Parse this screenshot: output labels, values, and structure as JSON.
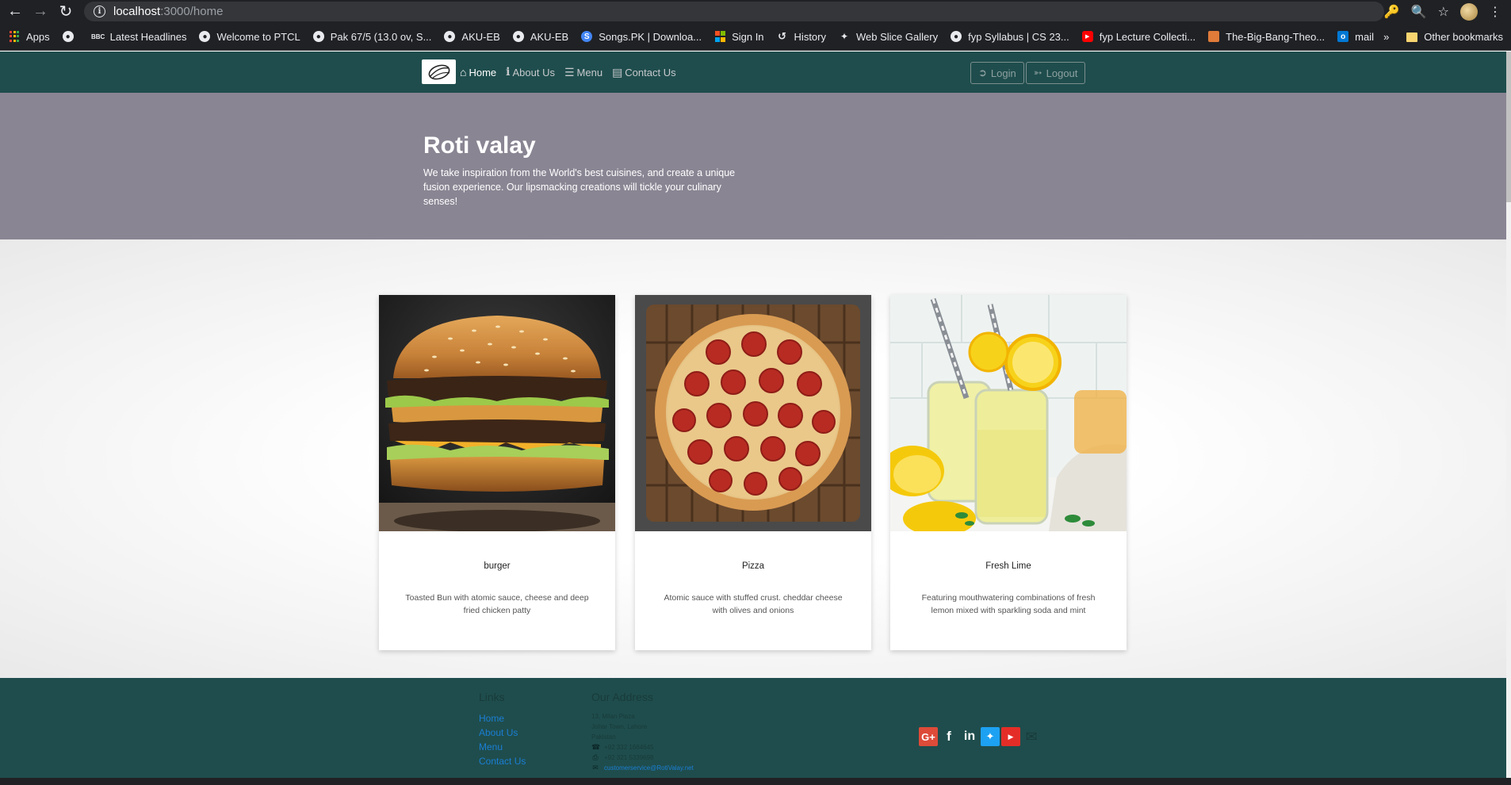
{
  "browser": {
    "url_host": "localhost",
    "url_path": ":3000/home",
    "bookmarks": [
      {
        "label": "Apps",
        "icon": "apps-grid-icon"
      },
      {
        "label": "",
        "icon": "globe-icon"
      },
      {
        "label": "Latest Headlines",
        "icon": "bbc-icon"
      },
      {
        "label": "Welcome to PTCL",
        "icon": "globe-icon"
      },
      {
        "label": "Pak 67/5 (13.0 ov, S...",
        "icon": "globe-icon"
      },
      {
        "label": "AKU-EB",
        "icon": "globe-icon"
      },
      {
        "label": "AKU-EB",
        "icon": "globe-icon"
      },
      {
        "label": "Songs.PK | Downloa...",
        "icon": "songs-icon"
      },
      {
        "label": "Sign In",
        "icon": "microsoft-icon"
      },
      {
        "label": "History",
        "icon": "history-icon"
      },
      {
        "label": "Web Slice Gallery",
        "icon": "web-slice-icon"
      },
      {
        "label": "fyp Syllabus | CS 23...",
        "icon": "globe-icon"
      },
      {
        "label": "fyp Lecture Collecti...",
        "icon": "youtube-icon"
      },
      {
        "label": "The-Big-Bang-Theo...",
        "icon": "tbbt-icon"
      },
      {
        "label": "mail official",
        "icon": "outlook-icon"
      }
    ],
    "more_label": "»",
    "other_bookmarks": "Other bookmarks"
  },
  "nav": {
    "home": "Home",
    "about": "About Us",
    "menu": "Menu",
    "contact": "Contact Us",
    "login": "Login",
    "logout": "Logout"
  },
  "hero": {
    "title": "Roti valay",
    "text": "We take inspiration from the World's best cuisines, and create a unique fusion experience. Our lipsmacking creations will tickle your culinary senses!"
  },
  "cards": [
    {
      "title": "burger",
      "desc": "Toasted Bun with atomic sauce, cheese and deep fried chicken patty"
    },
    {
      "title": "Pizza",
      "desc": "Atomic sauce with stuffed crust. cheddar cheese with olives and onions"
    },
    {
      "title": "Fresh Lime",
      "desc": "Featuring mouthwatering combinations of fresh lemon mixed with sparkling soda and mint"
    }
  ],
  "footer": {
    "links_heading": "Links",
    "links": [
      "Home",
      "About Us",
      "Menu",
      "Contact Us"
    ],
    "address_heading": "Our Address",
    "address_lines": [
      "13, Milan Plaza",
      "Johar Town, Lahore",
      "Pakistan"
    ],
    "phone": "+92 332 1664645",
    "fax": "+92 321 5339698",
    "email": "customerservice@RotiValay.net"
  },
  "colors": {
    "navbar": "#1f4d4d",
    "hero": "#8a8593",
    "footer": "#1f4d4d",
    "link": "#1a7ed4"
  }
}
